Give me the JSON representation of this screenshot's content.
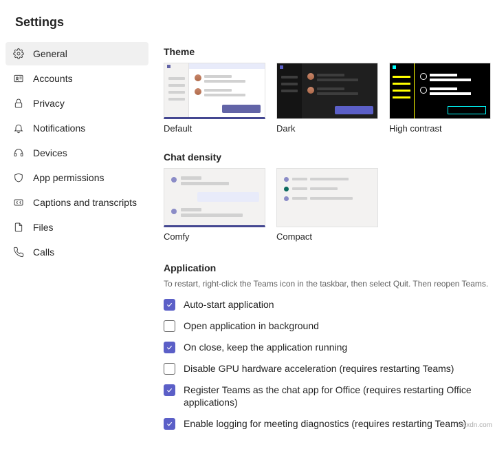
{
  "title": "Settings",
  "sidebar": {
    "items": [
      {
        "label": "General"
      },
      {
        "label": "Accounts"
      },
      {
        "label": "Privacy"
      },
      {
        "label": "Notifications"
      },
      {
        "label": "Devices"
      },
      {
        "label": "App permissions"
      },
      {
        "label": "Captions and transcripts"
      },
      {
        "label": "Files"
      },
      {
        "label": "Calls"
      }
    ],
    "active": 0
  },
  "theme": {
    "title": "Theme",
    "options": [
      {
        "label": "Default"
      },
      {
        "label": "Dark"
      },
      {
        "label": "High contrast"
      }
    ],
    "selected": 0
  },
  "density": {
    "title": "Chat density",
    "options": [
      {
        "label": "Comfy"
      },
      {
        "label": "Compact"
      }
    ],
    "selected": 0
  },
  "application": {
    "title": "Application",
    "description": "To restart, right-click the Teams icon in the taskbar, then select Quit. Then reopen Teams.",
    "options": [
      {
        "label": "Auto-start application",
        "checked": true
      },
      {
        "label": "Open application in background",
        "checked": false
      },
      {
        "label": "On close, keep the application running",
        "checked": true
      },
      {
        "label": "Disable GPU hardware acceleration (requires restarting Teams)",
        "checked": false
      },
      {
        "label": "Register Teams as the chat app for Office (requires restarting Office applications)",
        "checked": true
      },
      {
        "label": "Enable logging for meeting diagnostics (requires restarting Teams)",
        "checked": true
      }
    ]
  },
  "watermark": "wsxdn.com"
}
